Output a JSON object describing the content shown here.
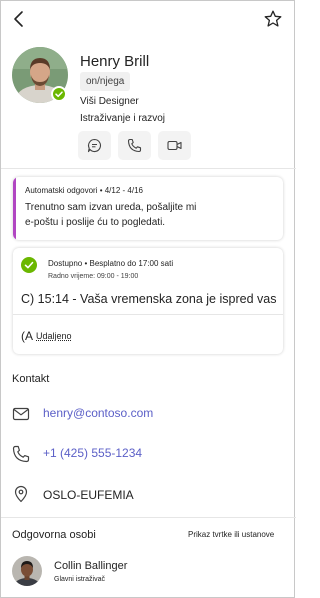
{
  "profile": {
    "name": "Henry Brill",
    "pronouns": "on/njega",
    "job_title": "Viši Designer",
    "department": "Istraživanje i razvoj",
    "presence_color": "#6bb700"
  },
  "toolbar": {
    "back_icon": "chevron-left-icon",
    "favorite_icon": "star-icon"
  },
  "actions": [
    {
      "icon": "chat-icon"
    },
    {
      "icon": "phone-icon"
    },
    {
      "icon": "video-icon"
    }
  ],
  "auto_reply": {
    "header": "Automatski odgovori • 4/12 - 4/16",
    "line1": "Trenutno sam izvan ureda, pošaljite mi",
    "line2": "e-poštu i poslije ću to pogledati.",
    "accent_color": "#b146c2"
  },
  "availability": {
    "status": "Dostupno • Besplatno do 17:00 sati",
    "working_hours": "Radno vrijeme: 09:00 - 19:00",
    "timezone": "C) 15:14 - Vaša vremenska zona je ispred vas",
    "location_icon_letter": "(A",
    "location_type": "Udaljeno"
  },
  "contact": {
    "heading": "Kontakt",
    "email": "henry@contoso.com",
    "phone": "+1 (425) 555-1234",
    "office": "OSLO-EUFEMIA",
    "link_color": "#5b5fc7"
  },
  "reports_to": {
    "heading": "Odgovorna osobi",
    "org_link": "Prikaz tvrtke ili ustanove",
    "manager_name": "Collin Ballinger",
    "manager_title": "Glavni istraživač"
  }
}
